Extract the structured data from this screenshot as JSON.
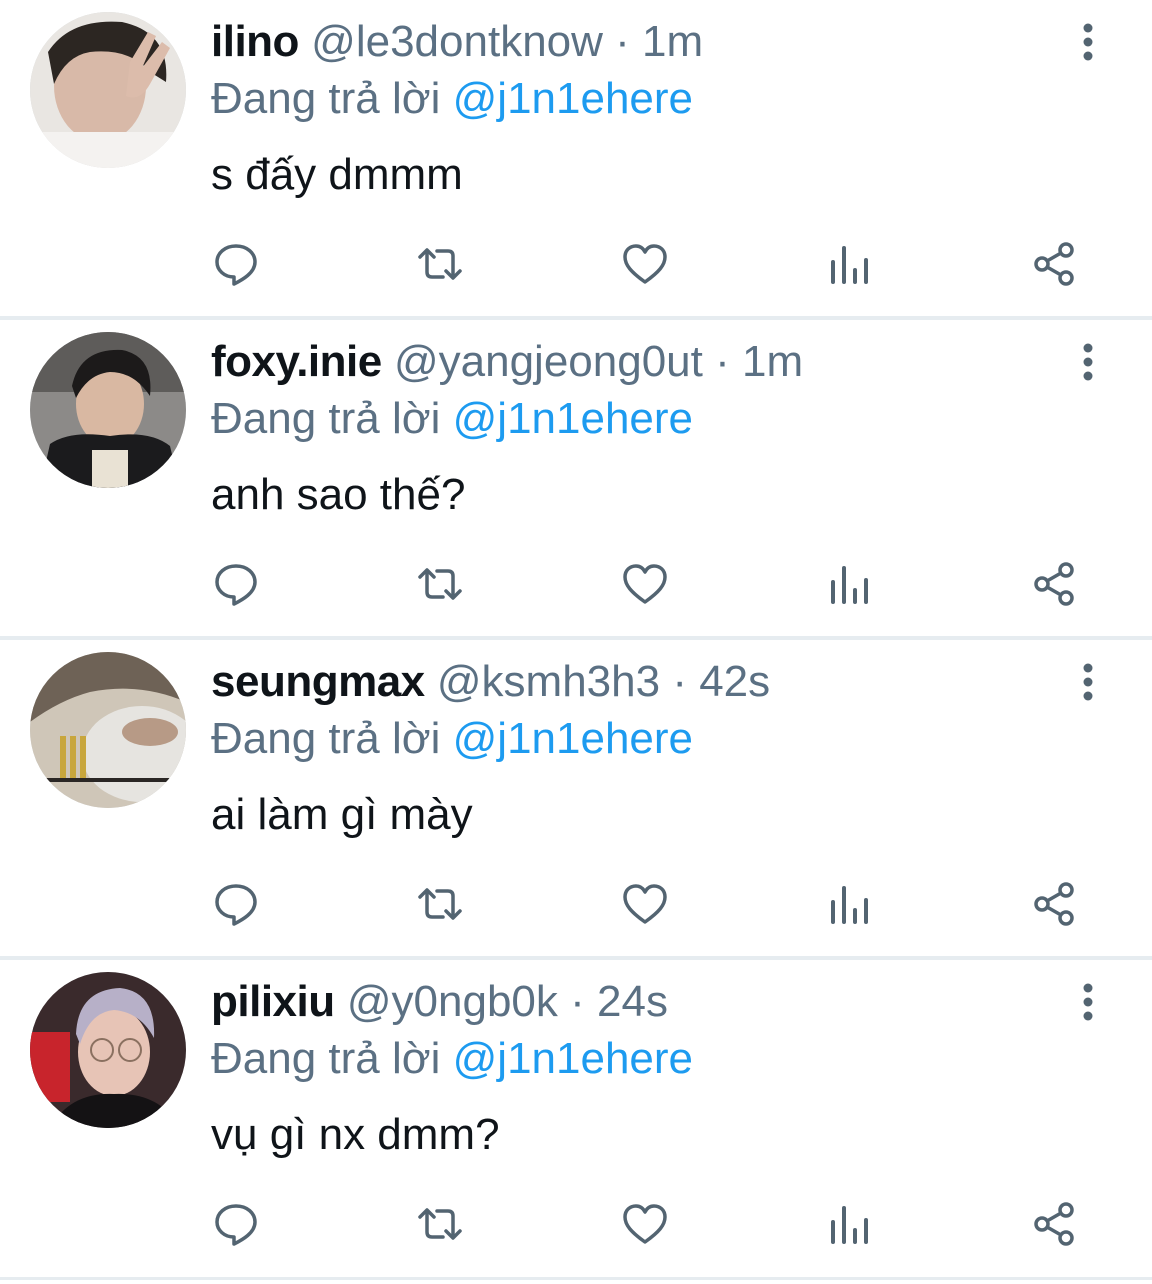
{
  "colors": {
    "text": "#0f1419",
    "muted": "#5b7083",
    "accent": "#1d9bf0",
    "divider": "#e6ecf0",
    "icon": "#536471"
  },
  "icons": {
    "more": "more-vertical-icon",
    "reply": "reply-icon",
    "retweet": "retweet-icon",
    "like": "heart-icon",
    "stats": "analytics-icon",
    "share": "share-icon"
  },
  "tweets": [
    {
      "name": "ilino",
      "handle": "@le3dontknow",
      "sep": "·",
      "time": "1m",
      "reply_prefix": "Đang trả lời",
      "mention": "@j1n1ehere",
      "text": "s đấy dmmm"
    },
    {
      "name": "foxy.inie",
      "handle": "@yangjeong0ut",
      "sep": "·",
      "time": "1m",
      "reply_prefix": "Đang trả lời",
      "mention": "@j1n1ehere",
      "text": "anh sao thế?"
    },
    {
      "name": "seungmax",
      "handle": "@ksmh3h3",
      "sep": "·",
      "time": "42s",
      "reply_prefix": "Đang trả lời",
      "mention": "@j1n1ehere",
      "text": "ai làm gì mày"
    },
    {
      "name": "pilixiu",
      "handle": "@y0ngb0k",
      "sep": "·",
      "time": "24s",
      "reply_prefix": "Đang trả lời",
      "mention": "@j1n1ehere",
      "text": "vụ gì nx dmm?"
    }
  ]
}
